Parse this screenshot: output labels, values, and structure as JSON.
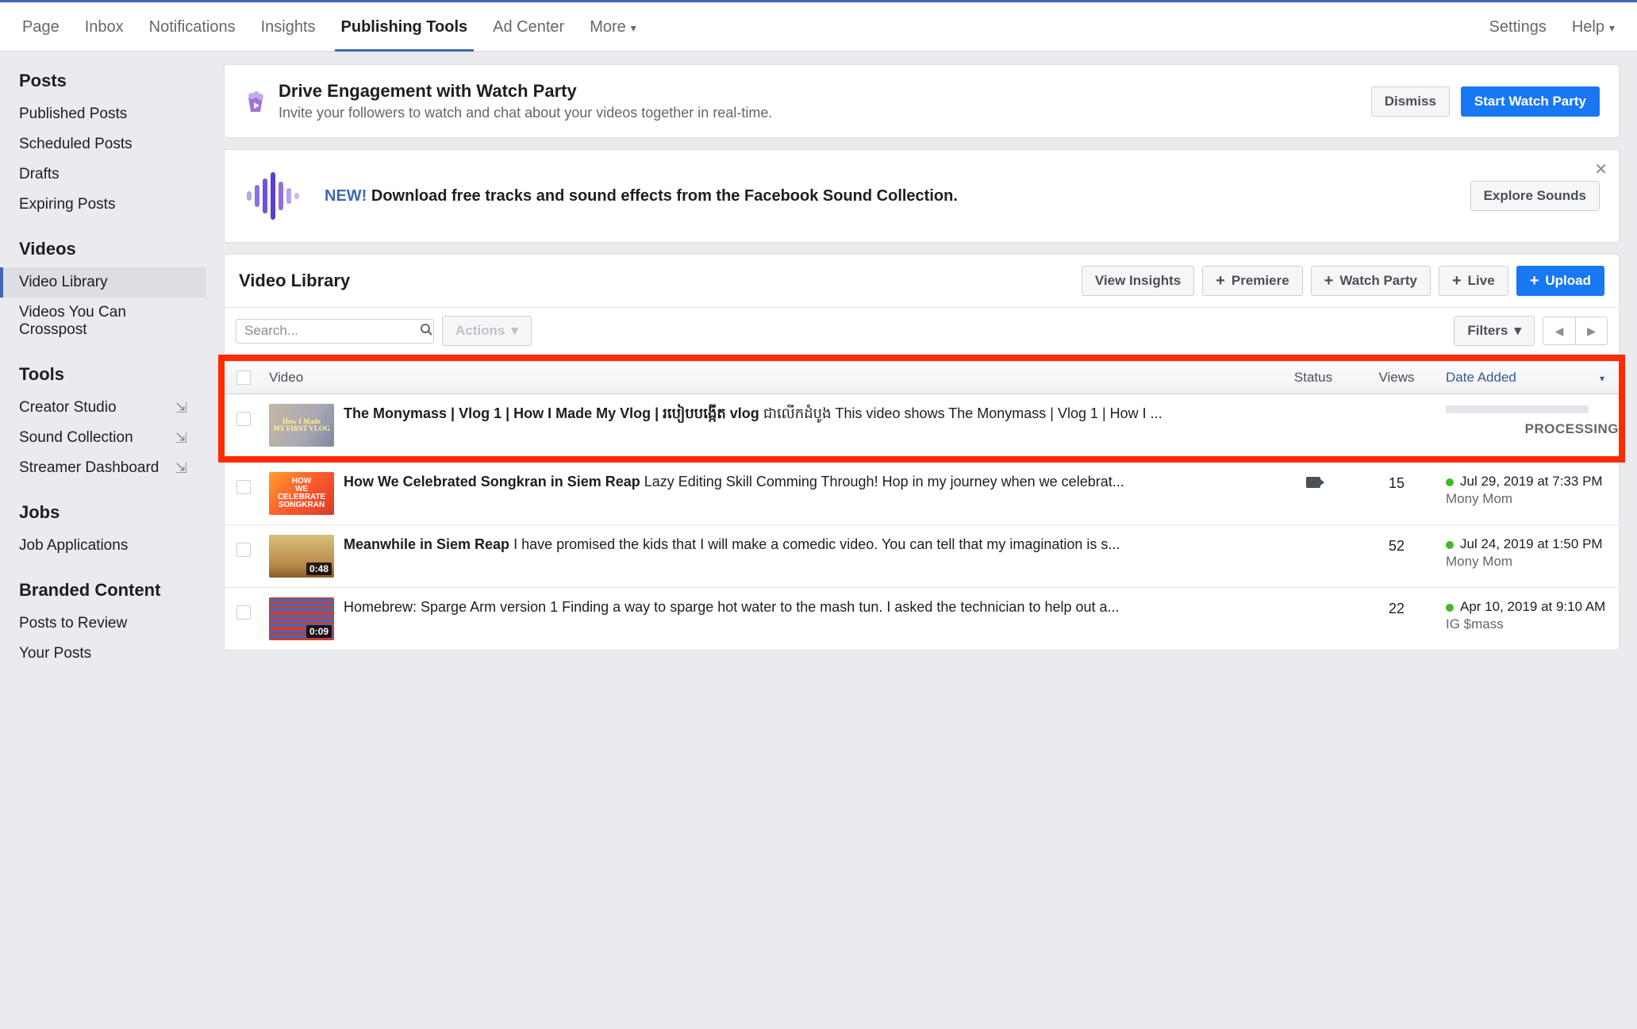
{
  "tabs": {
    "page": "Page",
    "inbox": "Inbox",
    "notifications": "Notifications",
    "insights": "Insights",
    "publishing_tools": "Publishing Tools",
    "ad_center": "Ad Center",
    "more": "More",
    "settings": "Settings",
    "help": "Help"
  },
  "sidebar": {
    "posts": {
      "title": "Posts",
      "published": "Published Posts",
      "scheduled": "Scheduled Posts",
      "drafts": "Drafts",
      "expiring": "Expiring Posts"
    },
    "videos": {
      "title": "Videos",
      "library": "Video Library",
      "crosspost": "Videos You Can Crosspost"
    },
    "tools": {
      "title": "Tools",
      "creator": "Creator Studio",
      "sound": "Sound Collection",
      "streamer": "Streamer Dashboard"
    },
    "jobs": {
      "title": "Jobs",
      "applications": "Job Applications"
    },
    "branded": {
      "title": "Branded Content",
      "review": "Posts to Review",
      "your": "Your Posts"
    }
  },
  "watch_party": {
    "title": "Drive Engagement with Watch Party",
    "subtitle": "Invite your followers to watch and chat about your videos together in real-time.",
    "dismiss": "Dismiss",
    "start": "Start Watch Party"
  },
  "sound": {
    "new": "NEW!",
    "text": "Download free tracks and sound effects from the Facebook Sound Collection.",
    "explore": "Explore Sounds"
  },
  "library": {
    "title": "Video Library",
    "view_insights": "View Insights",
    "premiere": "Premiere",
    "watch_party": "Watch Party",
    "live": "Live",
    "upload": "Upload",
    "search_placeholder": "Search...",
    "actions": "Actions",
    "filters": "Filters",
    "columns": {
      "video": "Video",
      "status": "Status",
      "views": "Views",
      "date": "Date Added"
    },
    "processing": "PROCESSING",
    "rows": [
      {
        "title": "The Monymass | Vlog 1 | How I Made My Vlog | របៀបបង្កើត vlog",
        "desc": " ជាលើកដំបូង This video shows The Monymass | Vlog 1 | How I ...",
        "views": "",
        "date": "",
        "author": "",
        "duration": "",
        "processing": true
      },
      {
        "title": "How We Celebrated Songkran in Siem Reap",
        "desc": " Lazy Editing Skill Comming Through! Hop in my journey when we celebrat...",
        "views": "15",
        "date": "Jul 29, 2019 at 7:33 PM",
        "author": "Mony Mom",
        "duration": "",
        "has_cam": true
      },
      {
        "title": "Meanwhile in Siem Reap",
        "desc": " I have promised the kids that I will make a comedic video. You can tell that my imagination is s...",
        "views": "52",
        "date": "Jul 24, 2019 at 1:50 PM",
        "author": "Mony Mom",
        "duration": "0:48"
      },
      {
        "title": "",
        "desc": "Homebrew: Sparge Arm version 1 Finding a way to sparge hot water to the mash tun. I asked the technician to help out a...",
        "views": "22",
        "date": "Apr 10, 2019 at 9:10 AM",
        "author": "IG $mass",
        "duration": "0:09"
      }
    ]
  }
}
